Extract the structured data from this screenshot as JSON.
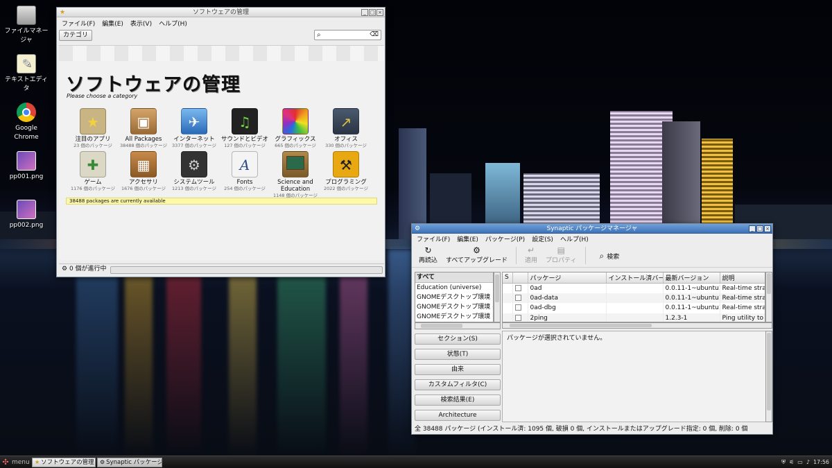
{
  "desktop": {
    "icons": [
      {
        "label": "ファイルマネージャ",
        "icon": "file-manager-icon"
      },
      {
        "label": "テキストエディタ",
        "icon": "text-editor-icon"
      },
      {
        "label": "Google Chrome",
        "icon": "chrome-icon"
      },
      {
        "label": "pp001.png",
        "icon": "png-file-icon"
      },
      {
        "label": "pp002.png",
        "icon": "png-file-icon"
      }
    ]
  },
  "software_center": {
    "title": "ソフトウェアの管理",
    "menu": [
      "ファイル(F)",
      "編集(E)",
      "表示(V)",
      "ヘルプ(H)"
    ],
    "category_button": "カテゴリ",
    "search_value": "",
    "heading": "ソフトウェアの管理",
    "subheading": "Please choose a category",
    "categories": [
      {
        "label": "注目のアプリ",
        "count": "23 個のパッケージ",
        "icon": "star-icon",
        "color": "#c9b583"
      },
      {
        "label": "All Packages",
        "count": "38488 個のパッケージ",
        "icon": "package-box-icon",
        "color": "#b98a55"
      },
      {
        "label": "インターネット",
        "count": "3377 個のパッケージ",
        "icon": "globe-icon",
        "color": "#4f8fd8"
      },
      {
        "label": "サウンドとビデオ",
        "count": "127 個のパッケージ",
        "icon": "music-note-icon",
        "color": "#2c2c2c"
      },
      {
        "label": "グラフィックス",
        "count": "665 個のパッケージ",
        "icon": "color-wheel-icon",
        "color": "#e05a8a"
      },
      {
        "label": "オフィス",
        "count": "330 個のパッケージ",
        "icon": "chart-icon",
        "color": "#3a4a5a"
      },
      {
        "label": "ゲーム",
        "count": "1176 個のパッケージ",
        "icon": "gamepad-icon",
        "color": "#d9d6c4"
      },
      {
        "label": "アクセサリ",
        "count": "1676 個のパッケージ",
        "icon": "calculator-icon",
        "color": "#b57b3c"
      },
      {
        "label": "システムツール",
        "count": "1213 個のパッケージ",
        "icon": "gear-icon",
        "color": "#3b3b3b"
      },
      {
        "label": "Fonts",
        "count": "254 個のパッケージ",
        "icon": "font-icon",
        "color": "#f2f2f2"
      },
      {
        "label": "Science and Education",
        "count": "1148 個のパッケージ",
        "icon": "science-board-icon",
        "color": "#9a7a3e"
      },
      {
        "label": "プログラミング",
        "count": "2022 個のパッケージ",
        "icon": "construction-icon",
        "color": "#e0a010"
      }
    ],
    "available_notice": "38488 packages are currently available",
    "status_text": "0 個が進行中"
  },
  "synaptic": {
    "title": "Synaptic パッケージマネージャ",
    "menu": [
      "ファイル(F)",
      "編集(E)",
      "パッケージ(P)",
      "設定(S)",
      "ヘルプ(H)"
    ],
    "toolbar": {
      "reload": "再読込",
      "upgrade_all": "すべてアップグレード",
      "apply": "適用",
      "properties": "プロパティ",
      "search": "検索"
    },
    "filters": [
      "すべて",
      "Education (universe)",
      "GNOMEデスクトップ環境",
      "GNOMEデスクトップ環境 (m",
      "GNOMEデスクトップ環境 (u"
    ],
    "section_buttons": [
      "セクション(S)",
      "状態(T)",
      "由来",
      "カスタムフィルタ(C)",
      "検索結果(E)",
      "Architecture"
    ],
    "columns": [
      "S",
      "パッケージ",
      "インストール済バー",
      "最新バージョン",
      "説明"
    ],
    "rows": [
      {
        "name": "0ad",
        "installed": "",
        "latest": "0.0.11-1~ubuntu12.",
        "desc": "Real-time strat"
      },
      {
        "name": "0ad-data",
        "installed": "",
        "latest": "0.0.11-1~ubuntu12.",
        "desc": "Real-time strat"
      },
      {
        "name": "0ad-dbg",
        "installed": "",
        "latest": "0.0.11-1~ubuntu12.",
        "desc": "Real-time strat"
      },
      {
        "name": "2ping",
        "installed": "",
        "latest": "1.2.3-1",
        "desc": "Ping utility to d"
      }
    ],
    "details_text": "パッケージが選択されていません。",
    "status_text": "全 38488 パッケージ (インストール済: 1095 個, 破損 0 個, インストールまたはアップグレード指定: 0 個, 削除: 0 個"
  },
  "taskbar": {
    "menu_label": "menu",
    "tasks": [
      "ソフトウェアの管理",
      "Synaptic パッケージ..."
    ],
    "clock": "17:56"
  }
}
